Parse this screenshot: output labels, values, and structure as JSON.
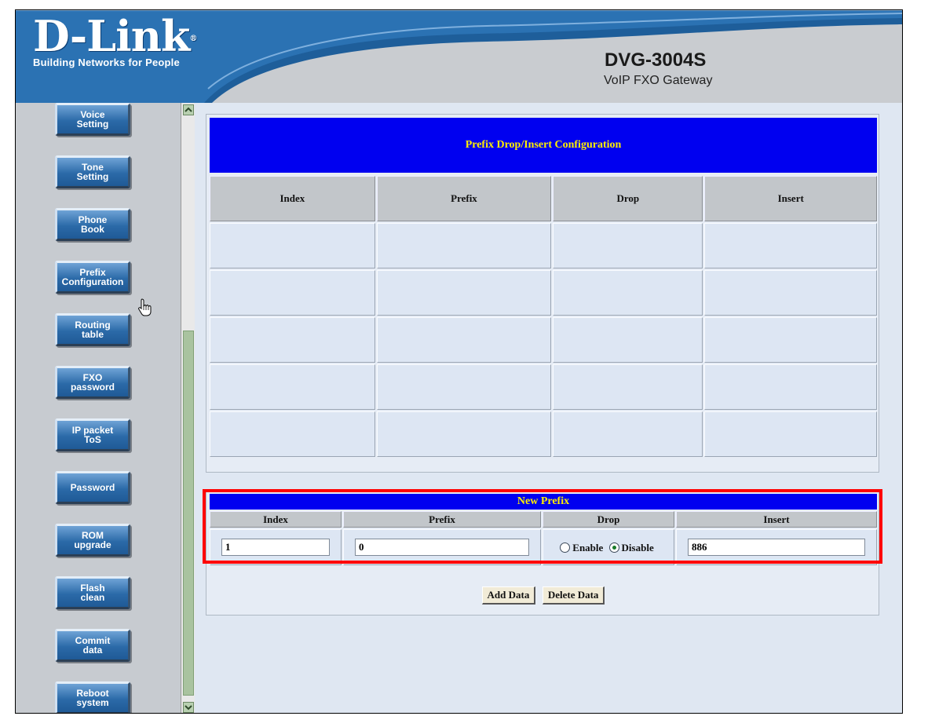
{
  "header": {
    "brand": "D-Link",
    "tagline": "Building Networks for People",
    "model": "DVG-3004S",
    "subtitle": "VoIP FXO Gateway"
  },
  "sidebar": {
    "items": [
      {
        "label": "Voice\nSetting"
      },
      {
        "label": "Tone\nSetting"
      },
      {
        "label": "Phone\nBook"
      },
      {
        "label": "Prefix\nConfiguration"
      },
      {
        "label": "Routing\ntable"
      },
      {
        "label": "FXO\npassword"
      },
      {
        "label": "IP packet\nToS"
      },
      {
        "label": "Password"
      },
      {
        "label": "ROM\nupgrade"
      },
      {
        "label": "Flash\nclean"
      },
      {
        "label": "Commit\ndata"
      },
      {
        "label": "Reboot\nsystem"
      }
    ]
  },
  "prefix_list": {
    "title": "Prefix Drop/Insert Configuration",
    "columns": [
      "Index",
      "Prefix",
      "Drop",
      "Insert"
    ],
    "rows": [
      [
        "",
        "",
        "",
        ""
      ],
      [
        "",
        "",
        "",
        ""
      ],
      [
        "",
        "",
        "",
        ""
      ],
      [
        "",
        "",
        "",
        ""
      ],
      [
        "",
        "",
        "",
        ""
      ]
    ]
  },
  "new_prefix": {
    "title": "New Prefix",
    "columns": [
      "Index",
      "Prefix",
      "Drop",
      "Insert"
    ],
    "index_value": "1",
    "prefix_value": "0",
    "drop_enable_label": "Enable",
    "drop_disable_label": "Disable",
    "drop_selected": "Disable",
    "insert_value": "886"
  },
  "buttons": {
    "add": "Add Data",
    "delete": "Delete Data"
  },
  "colors": {
    "title_bar": "#0000f0",
    "title_text": "#ffee00",
    "highlight": "#ff0000",
    "nav_button": "#2b6aa8"
  }
}
